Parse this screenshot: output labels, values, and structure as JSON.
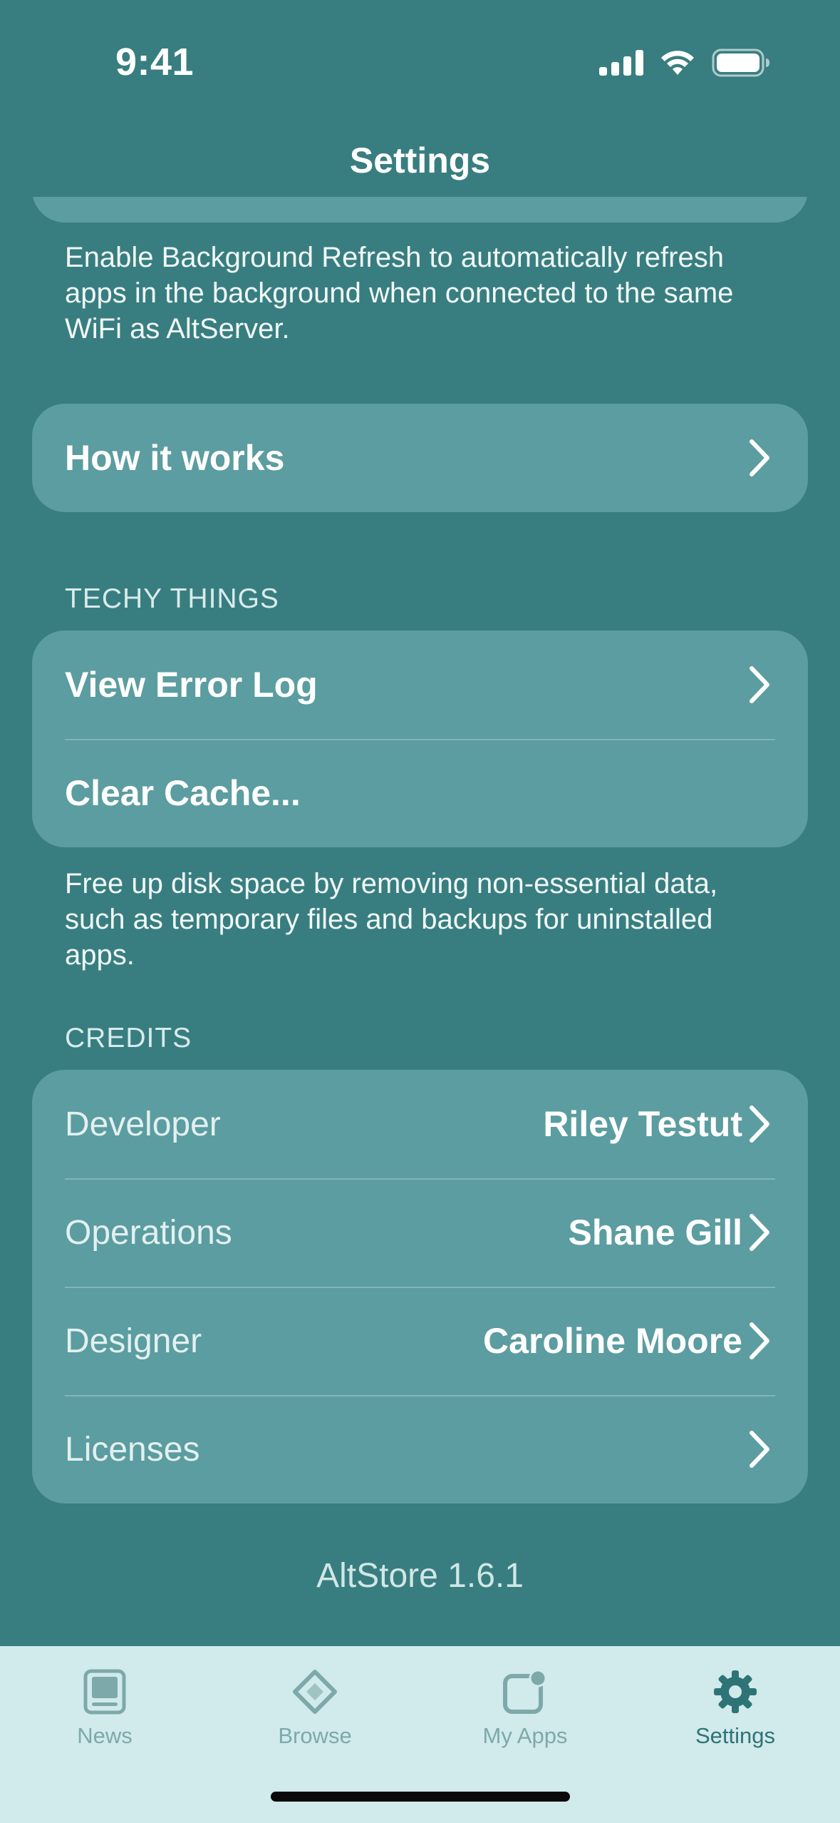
{
  "status_bar": {
    "time": "9:41"
  },
  "nav": {
    "title": "Settings"
  },
  "background_refresh": {
    "footer": "Enable Background Refresh to automatically refresh apps in the background when connected to the same WiFi as AltServer."
  },
  "how_it_works": {
    "label": "How it works"
  },
  "techy_things": {
    "header": "TECHY THINGS",
    "items": [
      {
        "label": "View Error Log",
        "chevron": true
      },
      {
        "label": "Clear Cache...",
        "chevron": false
      }
    ],
    "footer": "Free up disk space by removing non-essential data, such as temporary files and backups for uninstalled apps."
  },
  "credits": {
    "header": "CREDITS",
    "items": [
      {
        "label": "Developer",
        "value": "Riley Testut"
      },
      {
        "label": "Operations",
        "value": "Shane Gill"
      },
      {
        "label": "Designer",
        "value": "Caroline Moore"
      },
      {
        "label": "Licenses",
        "value": ""
      }
    ]
  },
  "version": "AltStore 1.6.1",
  "tab_bar": {
    "tabs": [
      {
        "label": "News",
        "icon": "news-icon",
        "active": false
      },
      {
        "label": "Browse",
        "icon": "browse-icon",
        "active": false
      },
      {
        "label": "My Apps",
        "icon": "my-apps-icon",
        "active": false
      },
      {
        "label": "Settings",
        "icon": "settings-gear-icon",
        "active": true
      }
    ]
  },
  "colors": {
    "background": "#387e80",
    "card": "#5b9da0",
    "tab_bar": "#d1eaeb",
    "tab_inactive": "#7ea9aa",
    "tab_active": "#2e7476"
  }
}
